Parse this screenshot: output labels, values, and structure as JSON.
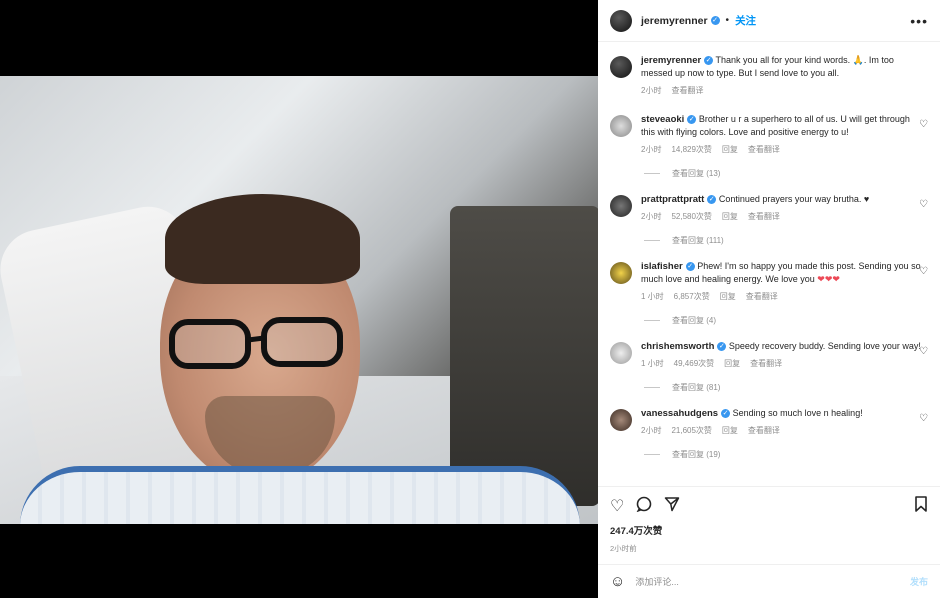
{
  "header": {
    "username": "jeremyrenner",
    "follow": "关注",
    "more": "•••"
  },
  "caption": {
    "username": "jeremyrenner",
    "text": "Thank you all for your kind words. 🙏. Im too messed up now to type. But I send love to you all.",
    "time": "2小时",
    "translate": "查看翻译"
  },
  "comments": [
    {
      "username": "steveaoki",
      "text": "Brother u r a superhero to all of us. U will get through this with flying colors. Love and positive energy to u!",
      "time": "2小时",
      "likes": "14,829次赞",
      "reply": "回复",
      "translate": "查看翻译",
      "replies": "查看回复 (13)"
    },
    {
      "username": "prattprattpratt",
      "text": "Continued prayers your way brutha. ♥",
      "time": "2小时",
      "likes": "52,580次赞",
      "reply": "回复",
      "translate": "查看翻译",
      "replies": "查看回复 (111)"
    },
    {
      "username": "islafisher",
      "text": "Phew! I'm so happy you made this post. Sending you so much love and healing energy. We love you",
      "hearts": "❤❤❤",
      "time": "1 小时",
      "likes": "6,857次赞",
      "reply": "回复",
      "translate": "查看翻译",
      "replies": "查看回复 (4)"
    },
    {
      "username": "chrishemsworth",
      "text": "Speedy recovery buddy. Sending love your way!",
      "time": "1 小时",
      "likes": "49,469次赞",
      "reply": "回复",
      "translate": "查看翻译",
      "replies": "查看回复 (81)"
    },
    {
      "username": "vanessahudgens",
      "text": "Sending so much love n healing!",
      "time": "2小时",
      "likes": "21,605次赞",
      "reply": "回复",
      "translate": "查看翻译",
      "replies": "查看回复 (19)"
    }
  ],
  "actions": {
    "likes": "247.4万次赞",
    "posted": "2小时前"
  },
  "add_comment": {
    "placeholder": "添加评论...",
    "post": "发布"
  },
  "colors": {
    "verified": "#3897f0",
    "link": "#0095f6",
    "like_heart": "#ed4956"
  }
}
